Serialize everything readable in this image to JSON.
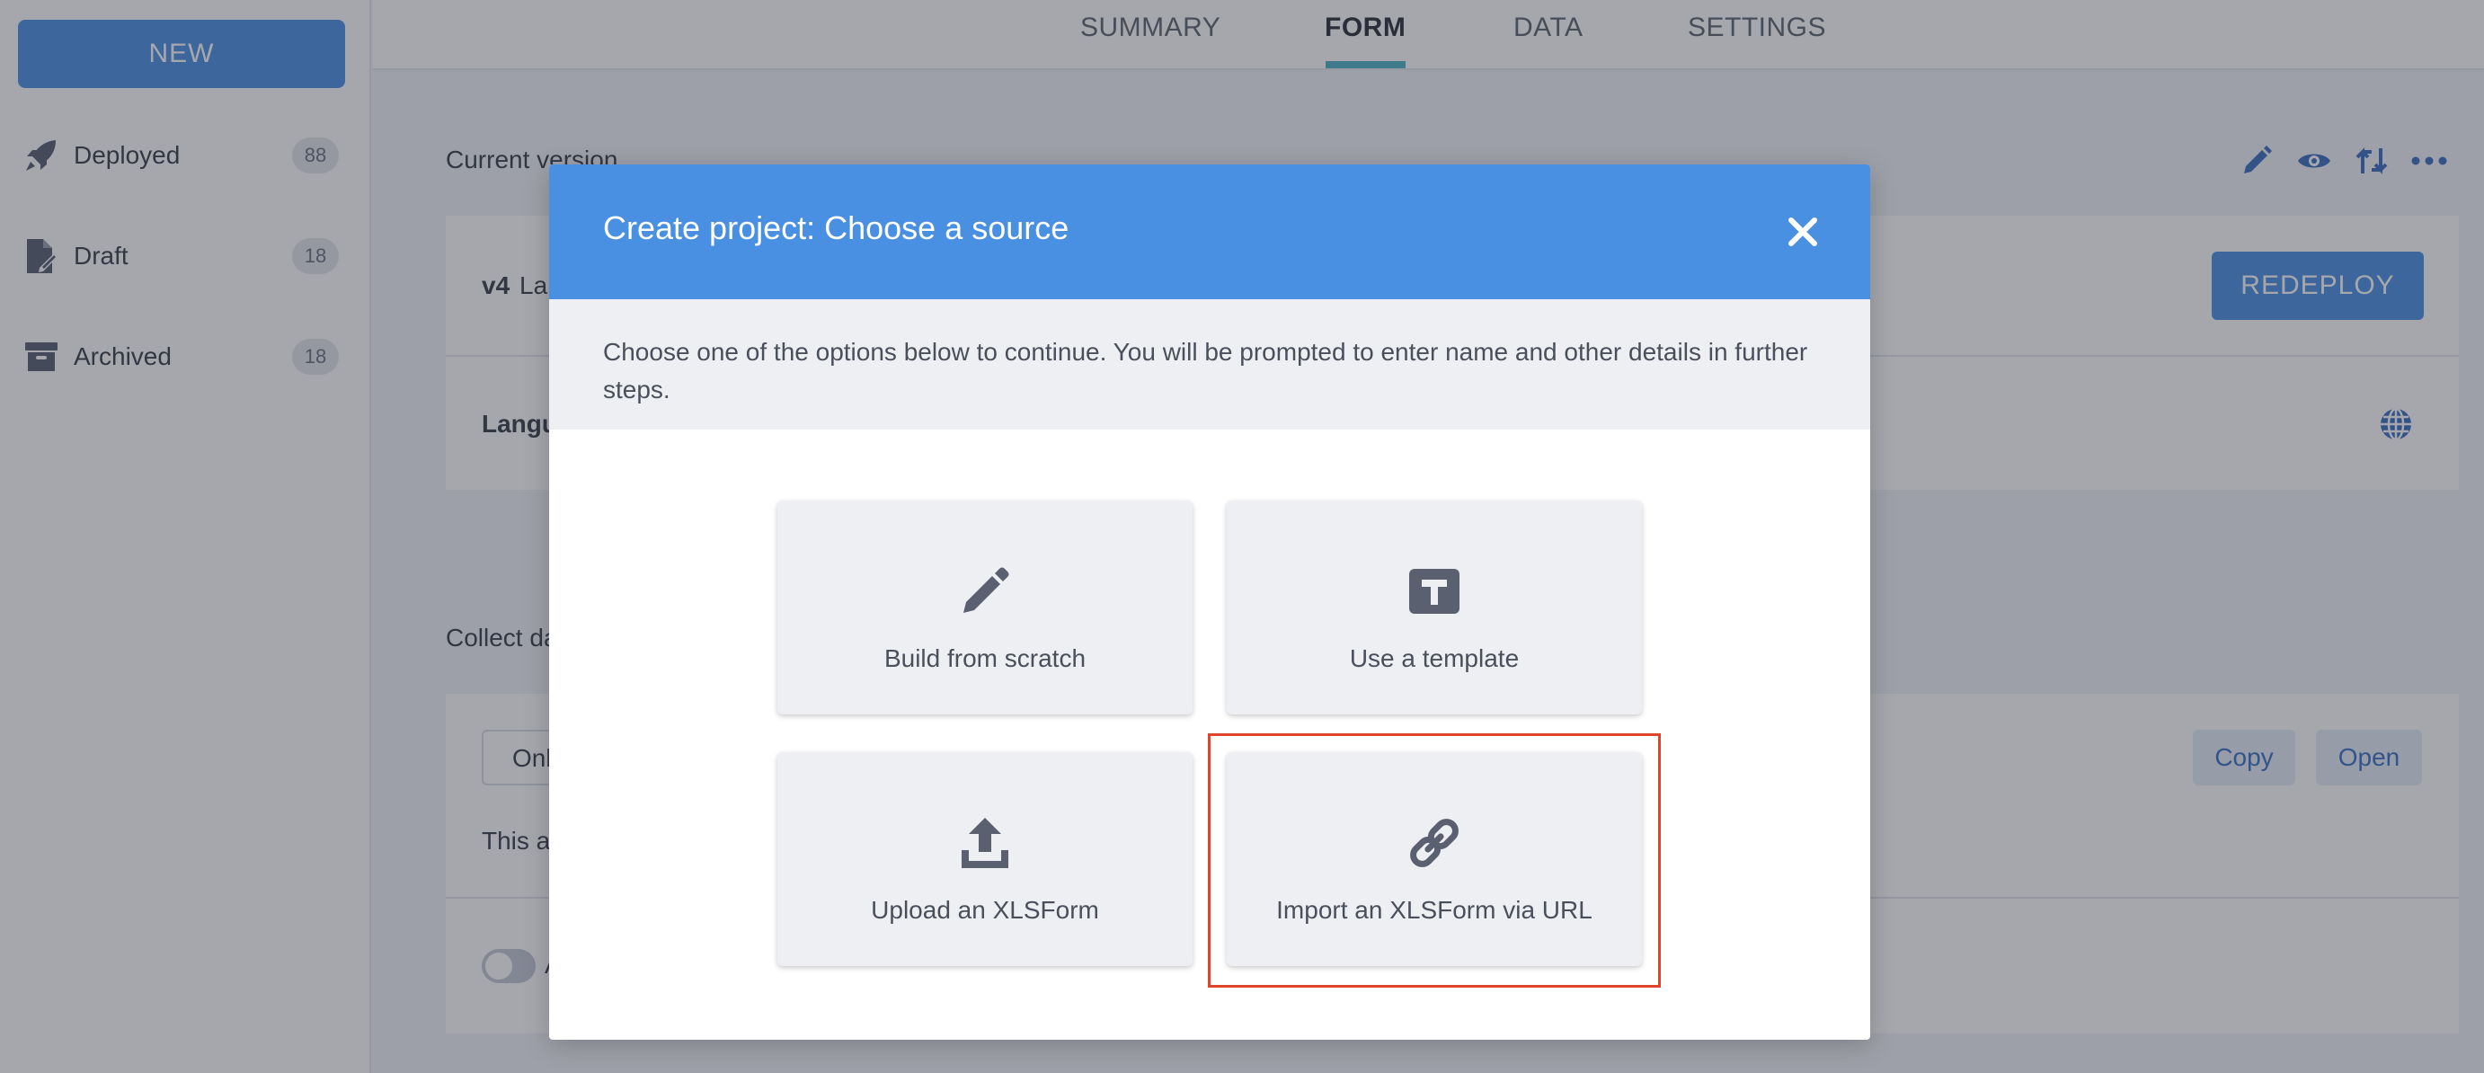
{
  "sidebar": {
    "new_label": "NEW",
    "items": [
      {
        "label": "Deployed",
        "count": "88",
        "icon": "rocket-icon"
      },
      {
        "label": "Draft",
        "count": "18",
        "icon": "draft-document-icon"
      },
      {
        "label": "Archived",
        "count": "18",
        "icon": "archive-box-icon"
      }
    ]
  },
  "tabs": [
    {
      "label": "SUMMARY"
    },
    {
      "label": "FORM"
    },
    {
      "label": "DATA"
    },
    {
      "label": "SETTINGS"
    }
  ],
  "form_page": {
    "current_version_label": "Current version",
    "version_badge": "v4",
    "version_text_partial": "La",
    "languages_partial": "Langu",
    "redeploy_label": "REDEPLOY",
    "collect_data_partial": "Collect da",
    "select_value_partial": "Onl",
    "description_partial": "This a",
    "toggle_text_partial": "A",
    "copy_label": "Copy",
    "open_label": "Open",
    "header_icons": [
      "pencil-icon",
      "eye-icon",
      "sync-icon",
      "more-icon"
    ]
  },
  "modal": {
    "title": "Create project: Choose a source",
    "intro": "Choose one of the options below to continue. You will be prompted to enter name and other details in further steps.",
    "options": [
      {
        "label": "Build from scratch",
        "icon": "pencil-icon"
      },
      {
        "label": "Use a template",
        "icon": "template-icon"
      },
      {
        "label": "Upload an XLSForm",
        "icon": "upload-icon"
      },
      {
        "label": "Import an XLSForm via URL",
        "icon": "link-icon"
      }
    ]
  },
  "colors": {
    "primary": "#4a90e2",
    "tab_accent": "#4fb2c7",
    "highlight": "#e0452b",
    "icon": "#5a6070"
  }
}
